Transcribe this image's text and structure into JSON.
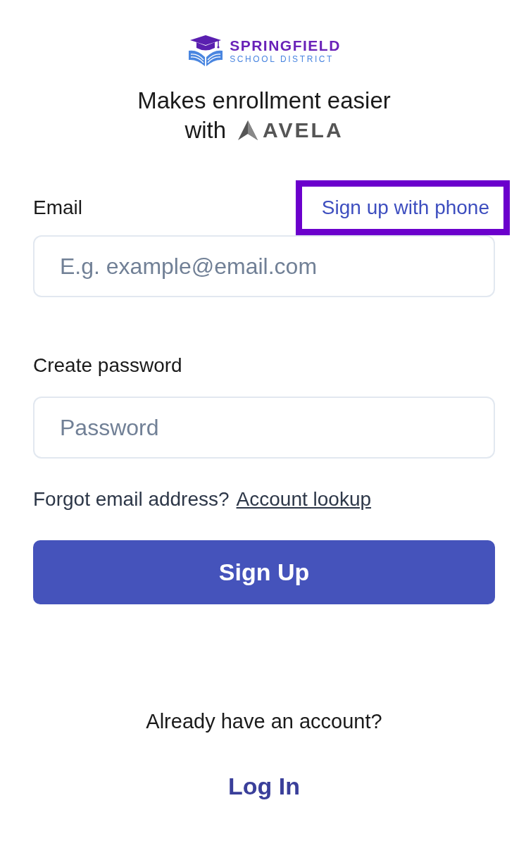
{
  "logo": {
    "name": "SPRINGFIELD",
    "subtitle": "SCHOOL DISTRICT"
  },
  "tagline": {
    "line_1": "Makes enrollment easier",
    "with": "with",
    "brand": "AVELA"
  },
  "email": {
    "label": "Email",
    "placeholder": "E.g. example@email.com"
  },
  "phone_link": {
    "label": "Sign up with phone",
    "highlighted": true
  },
  "password": {
    "label": "Create password",
    "placeholder": "Password"
  },
  "forgot": {
    "text": "Forgot email address?",
    "link": "Account lookup"
  },
  "submit_button": "Sign Up",
  "footer": {
    "text": "Already have an account?",
    "link": "Log In"
  }
}
